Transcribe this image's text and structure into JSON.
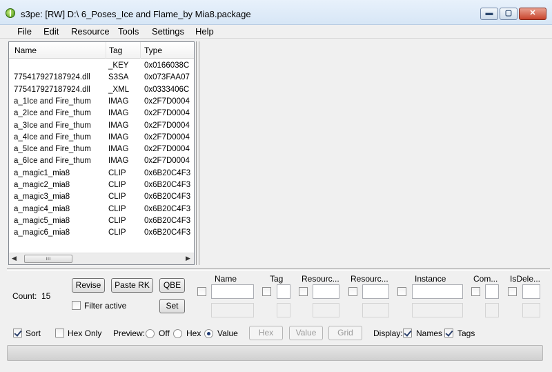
{
  "window": {
    "title": "s3pe: [RW] D:\\ 6_Poses_Ice and Flame_by Mia8.package",
    "min_glyph": "▬",
    "max_glyph": "▢",
    "close_glyph": "✕"
  },
  "menu": [
    "File",
    "Edit",
    "Resource",
    "Tools",
    "Settings",
    "Help"
  ],
  "list": {
    "columns": [
      "Name",
      "Tag",
      "Type"
    ],
    "rows": [
      {
        "name": "",
        "tag": "_KEY",
        "type": "0x0166038C"
      },
      {
        "name": "775417927187924.dll",
        "tag": "S3SA",
        "type": "0x073FAA07"
      },
      {
        "name": "775417927187924.dll",
        "tag": "_XML",
        "type": "0x0333406C"
      },
      {
        "name": "a_1Ice and Fire_thum",
        "tag": "IMAG",
        "type": "0x2F7D0004"
      },
      {
        "name": "a_2Ice and Fire_thum",
        "tag": "IMAG",
        "type": "0x2F7D0004"
      },
      {
        "name": "a_3Ice and Fire_thum",
        "tag": "IMAG",
        "type": "0x2F7D0004"
      },
      {
        "name": "a_4Ice and Fire_thum",
        "tag": "IMAG",
        "type": "0x2F7D0004"
      },
      {
        "name": "a_5Ice and Fire_thum",
        "tag": "IMAG",
        "type": "0x2F7D0004"
      },
      {
        "name": "a_6Ice and Fire_thum",
        "tag": "IMAG",
        "type": "0x2F7D0004"
      },
      {
        "name": "a_magic1_mia8",
        "tag": "CLIP",
        "type": "0x6B20C4F3"
      },
      {
        "name": "a_magic2_mia8",
        "tag": "CLIP",
        "type": "0x6B20C4F3"
      },
      {
        "name": "a_magic3_mia8",
        "tag": "CLIP",
        "type": "0x6B20C4F3"
      },
      {
        "name": "a_magic4_mia8",
        "tag": "CLIP",
        "type": "0x6B20C4F3"
      },
      {
        "name": "a_magic5_mia8",
        "tag": "CLIP",
        "type": "0x6B20C4F3"
      },
      {
        "name": "a_magic6_mia8",
        "tag": "CLIP",
        "type": "0x6B20C4F3"
      }
    ],
    "scroll_left": "◀",
    "scroll_right": "▶",
    "thumb_grip": "ııı"
  },
  "controls": {
    "count_label": "Count:",
    "count_value": "15",
    "revise": "Revise",
    "paste_rk": "Paste RK",
    "qbe": "QBE",
    "set": "Set",
    "filter_active": "Filter active",
    "filter_active_checked": false
  },
  "filters": [
    {
      "label": "Name",
      "checked": false
    },
    {
      "label": "Tag",
      "checked": false
    },
    {
      "label": "Resourc...",
      "checked": false
    },
    {
      "label": "Resourc...",
      "checked": false
    },
    {
      "label": "Instance",
      "checked": false
    },
    {
      "label": "Com...",
      "checked": false
    },
    {
      "label": "IsDele...",
      "checked": false
    }
  ],
  "bottom": {
    "sort": "Sort",
    "sort_checked": true,
    "hex_only": "Hex Only",
    "hex_only_checked": false,
    "preview": "Preview:",
    "off": "Off",
    "hex": "Hex",
    "value": "Value",
    "preview_selected": "Value",
    "btn_hex": "Hex",
    "btn_value": "Value",
    "btn_grid": "Grid",
    "display": "Display:",
    "names": "Names",
    "names_checked": true,
    "tags": "Tags",
    "tags_checked": true
  }
}
